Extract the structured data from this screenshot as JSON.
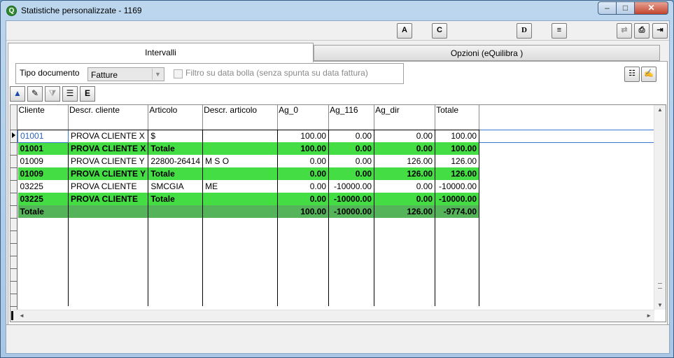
{
  "window": {
    "title": "Statistiche personalizzate - 1169",
    "controls": {
      "minimize": "–",
      "maximize": "□",
      "close": "✕"
    }
  },
  "toolbar": {
    "buttons": [
      {
        "glyph": "A",
        "icon": "font-a-icon"
      },
      {
        "glyph": "C",
        "icon": "font-c-icon"
      },
      {
        "glyph": "D",
        "icon": "letter-d-icon"
      },
      {
        "glyph": "≡",
        "icon": "list-document-icon"
      },
      {
        "glyph": "⇄",
        "icon": "refresh-icon"
      },
      {
        "glyph": "⎙",
        "icon": "print-icon"
      },
      {
        "glyph": "⇥",
        "icon": "exit-icon"
      }
    ]
  },
  "tabs": [
    {
      "label": "Intervalli",
      "active": true
    },
    {
      "label": "Opzioni (eQuilibra )",
      "active": false
    }
  ],
  "filters": {
    "tipo_label": "Tipo documento",
    "tipo_value": "Fatture",
    "checkbox_label": "Filtro su data bolla (senza spunta su data fattura)",
    "checkbox_checked": false
  },
  "grid_tools": [
    {
      "glyph": "▲",
      "icon": "triangle-up-icon"
    },
    {
      "glyph": "✎",
      "icon": "edit-checklist-icon"
    },
    {
      "glyph": "⧩",
      "icon": "filter-icon"
    },
    {
      "glyph": "☰",
      "icon": "column-list-icon"
    },
    {
      "glyph": "E",
      "icon": "export-excel-icon"
    }
  ],
  "table": {
    "columns": [
      "Cliente",
      "Descr. cliente",
      "Articolo",
      "Descr. articolo",
      "Ag_0",
      "Ag_116",
      "Ag_dir",
      "Totale"
    ],
    "rows": [
      {
        "type": "normal",
        "cells": [
          "01001",
          "PROVA CLIENTE X",
          "$",
          "",
          "100.00",
          "0.00",
          "0.00",
          "100.00"
        ]
      },
      {
        "type": "total",
        "cells": [
          "01001",
          "PROVA CLIENTE X",
          "Totale",
          "",
          "100.00",
          "0.00",
          "0.00",
          "100.00"
        ]
      },
      {
        "type": "normal",
        "cells": [
          "01009",
          "PROVA CLIENTE Y",
          "22800-26414",
          "M  S  O",
          "0.00",
          "0.00",
          "126.00",
          "126.00"
        ]
      },
      {
        "type": "total",
        "cells": [
          "01009",
          "PROVA CLIENTE Y",
          "Totale",
          "",
          "0.00",
          "0.00",
          "126.00",
          "126.00"
        ]
      },
      {
        "type": "normal",
        "cells": [
          "03225",
          "PROVA CLIENTE",
          "SMCGIA",
          "ME",
          "0.00",
          "-10000.00",
          "0.00",
          "-10000.00"
        ]
      },
      {
        "type": "total",
        "cells": [
          "03225",
          "PROVA CLIENTE",
          "Totale",
          "",
          "0.00",
          "-10000.00",
          "0.00",
          "-10000.00"
        ]
      },
      {
        "type": "grand",
        "cells": [
          "Totale",
          "",
          "",
          "",
          "100.00",
          "-10000.00",
          "126.00",
          "-9774.00"
        ]
      }
    ],
    "colors": {
      "total_row": "#44dd44",
      "grand_total_row": "#55b35a",
      "selection": "#3a7bd0"
    }
  },
  "scroll": {
    "up": "▲",
    "down": "▼",
    "left": "◄",
    "right": "►"
  },
  "right_buttons": [
    {
      "glyph": "☷",
      "icon": "document-icon"
    },
    {
      "glyph": "✍",
      "icon": "signature-icon"
    }
  ]
}
